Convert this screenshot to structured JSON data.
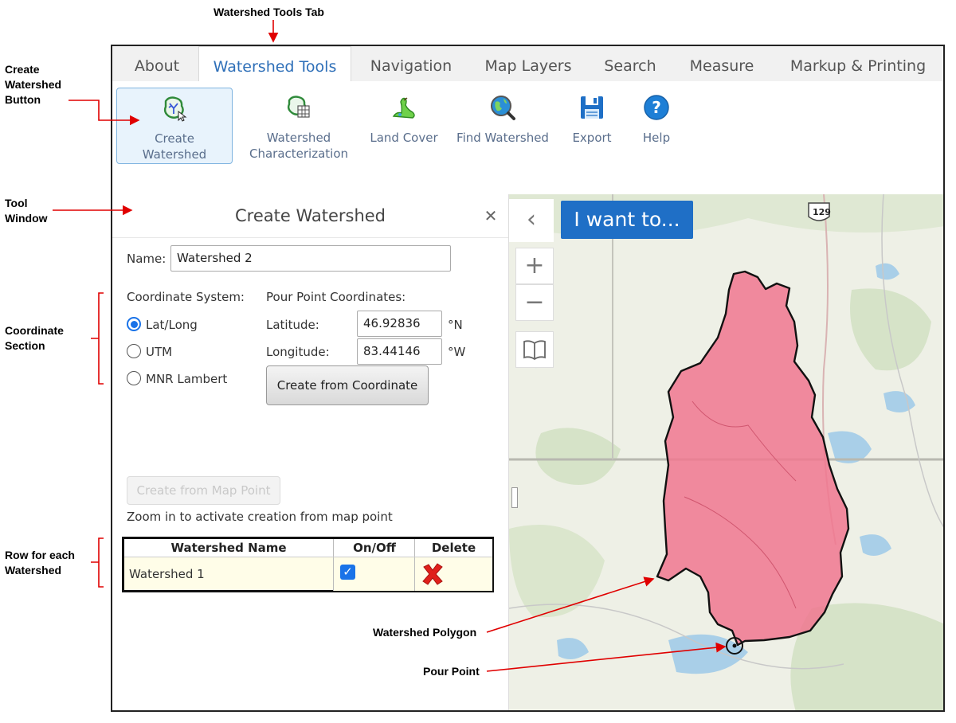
{
  "callouts": {
    "tabs_title": "Watershed Tools Tab",
    "create_button_line1": "Create",
    "create_button_line2": "Watershed",
    "create_button_line3": "Button",
    "tool_window_line1": "Tool",
    "tool_window_line2": "Window",
    "coordinate_line1": "Coordinate",
    "coordinate_line2": "Section",
    "row_line1": "Row for each",
    "row_line2": "Watershed",
    "polygon": "Watershed Polygon",
    "pour_point": "Pour Point"
  },
  "tabs": [
    {
      "label": "About"
    },
    {
      "label": "Watershed Tools"
    },
    {
      "label": "Navigation"
    },
    {
      "label": "Map Layers"
    },
    {
      "label": "Search"
    },
    {
      "label": "Measure"
    },
    {
      "label": "Markup & Printing"
    }
  ],
  "active_tab": "Watershed Tools",
  "ribbon": {
    "create_watershed": {
      "line1": "Create",
      "line2": "Watershed",
      "icon": "create-watershed-icon"
    },
    "characterization": {
      "line1": "Watershed",
      "line2": "Characterization",
      "icon": "characterization-icon"
    },
    "land_cover": {
      "label": "Land Cover",
      "icon": "land-cover-icon"
    },
    "find_watershed": {
      "label": "Find Watershed",
      "icon": "globe-search-icon"
    },
    "export": {
      "label": "Export",
      "icon": "save-icon"
    },
    "help": {
      "label": "Help",
      "icon": "help-icon"
    }
  },
  "tool_window": {
    "title": "Create Watershed",
    "close_glyph": "✕",
    "name_label": "Name:",
    "name_value": "Watershed 2",
    "coord_system_label": "Coordinate System:",
    "coord_options": [
      "Lat/Long",
      "UTM",
      "MNR Lambert"
    ],
    "coord_selected": "Lat/Long",
    "pour_point_label": "Pour Point Coordinates:",
    "latitude_label": "Latitude:",
    "latitude_value": "46.92836",
    "latitude_unit": "°N",
    "longitude_label": "Longitude:",
    "longitude_value": "83.44146",
    "longitude_unit": "°W",
    "create_from_coordinate": "Create from Coordinate",
    "create_from_map_point": "Create from Map Point",
    "zoom_hint": "Zoom in to activate creation from map point",
    "table": {
      "headers": [
        "Watershed Name",
        "On/Off",
        "Delete"
      ],
      "rows": [
        {
          "name": "Watershed 1",
          "on": true
        }
      ]
    }
  },
  "map": {
    "i_want_to": "I want to...",
    "highway_shield": "129",
    "colors": {
      "polygon_fill": "#f0778f",
      "water": "#a9cfe8",
      "forest": "#cfe0c0"
    }
  },
  "colors": {
    "accent": "#2e6fb8",
    "callout_arrow": "#e00000"
  }
}
